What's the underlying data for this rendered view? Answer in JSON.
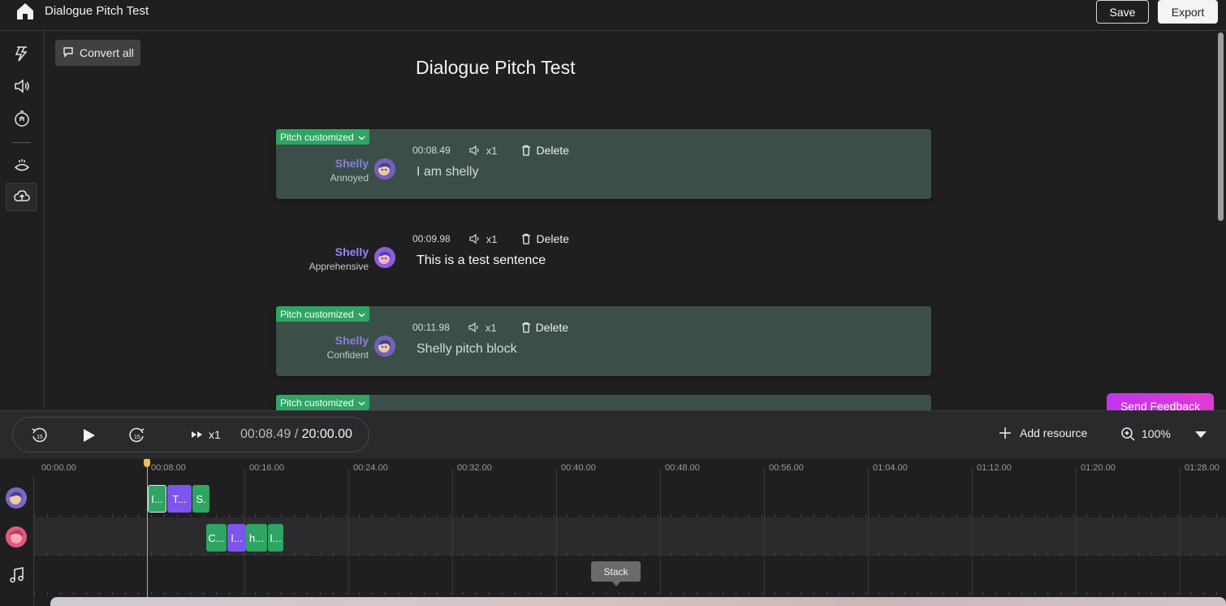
{
  "app": {
    "title": "Dialogue Pitch Test",
    "save_label": "Save",
    "export_label": "Export"
  },
  "toolbar": {
    "convert_all_label": "Convert all"
  },
  "document": {
    "title": "Dialogue Pitch Test",
    "lines": [
      {
        "tag": "Pitch customized",
        "time": "00:08.49",
        "speed": "x1",
        "delete_label": "Delete",
        "speaker": "Shelly",
        "emotion": "Annoyed",
        "text": "I am shelly"
      },
      {
        "tag": "",
        "time": "00:09.98",
        "speed": "x1",
        "delete_label": "Delete",
        "speaker": "Shelly",
        "emotion": "Apprehensive",
        "text": "This is a test sentence"
      },
      {
        "tag": "Pitch customized",
        "time": "00:11.98",
        "speed": "x1",
        "delete_label": "Delete",
        "speaker": "Shelly",
        "emotion": "Confident",
        "text": "Shelly pitch block"
      },
      {
        "tag": "Pitch customized"
      }
    ]
  },
  "feedback_label": "Send Feedback",
  "player": {
    "speed": "x1",
    "current_time": "00:08.49",
    "separator": " / ",
    "total_time": "20:00.00",
    "add_resource_label": "Add resource",
    "zoom_label": "100%"
  },
  "timeline": {
    "ticks": [
      "00:00.00",
      "00:08.00",
      "00:16.00",
      "00:24.00",
      "00:32.00",
      "00:40.00",
      "00:48.00",
      "00:56.00",
      "01:04.00",
      "01:12.00",
      "01:20.00",
      "01:28.00"
    ],
    "track1_clips": [
      "I...",
      "T...",
      "S."
    ],
    "track2_clips": [
      "C...",
      "I...",
      "h...",
      "I..."
    ],
    "tooltip": "Stack"
  },
  "colors": {
    "pitch_tag": "#2fa463",
    "block_bg": "#3b4f48",
    "clip_green": "#2fa463",
    "clip_purple": "#7d55ec",
    "playhead": "#e0a53a",
    "feedback_gradient_start": "#c135f0"
  },
  "icons": {
    "home": "home-icon",
    "sidebar": [
      "voice-effects-icon",
      "speaker-icon",
      "timer-icon",
      "ambience-icon",
      "upload-cloud-icon"
    ]
  }
}
